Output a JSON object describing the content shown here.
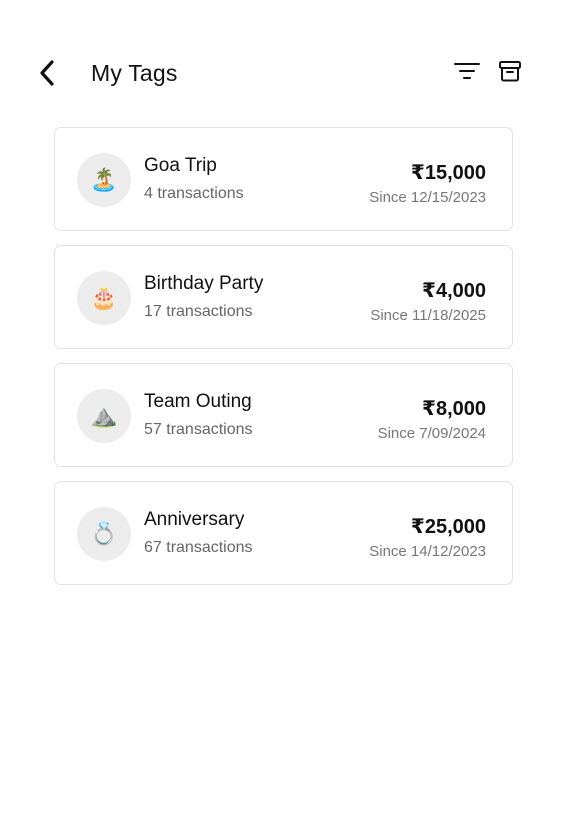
{
  "header": {
    "title": "My Tags",
    "back_icon": "chevron-left-icon",
    "filter_icon": "filter-icon",
    "archive_icon": "archive-icon"
  },
  "tags": [
    {
      "name": "Goa Trip",
      "transactions": "4 transactions",
      "amount": "₹15,000",
      "since": "Since 12/15/2023",
      "emoji": "🏝️"
    },
    {
      "name": "Birthday Party",
      "transactions": "17 transactions",
      "amount": "₹4,000",
      "since": "Since 11/18/2025",
      "emoji": "🎂"
    },
    {
      "name": "Team Outing",
      "transactions": "57 transactions",
      "amount": "₹8,000",
      "since": "Since 7/09/2024",
      "emoji": "⛰️"
    },
    {
      "name": "Anniversary",
      "transactions": " 67 transactions",
      "amount": "₹25,000",
      "since": "Since 14/12/2023",
      "emoji": "💍"
    }
  ]
}
